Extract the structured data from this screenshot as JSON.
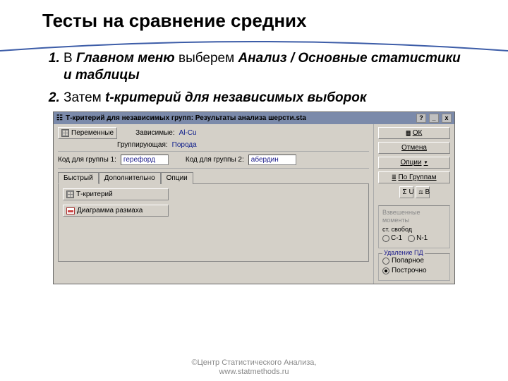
{
  "slide": {
    "title": "Тесты на сравнение средних",
    "items": [
      {
        "lead": "В ",
        "bold": "Главном меню",
        "mid": " выберем ",
        "ital": "Анализ / Основные статистики и таблицы"
      },
      {
        "lead": "Затем ",
        "ital": "t-критерий для независимых выборок"
      }
    ],
    "footer1": "©Центр Статистического Анализа,",
    "footer2": "www.statmethods.ru"
  },
  "win": {
    "title": "Т-критерий для независимых групп: Результаты анализа шерсти.sta",
    "close": "x",
    "min": "_",
    "help": "?",
    "vars_btn": "Переменные",
    "dep_lbl": "Зависимые:",
    "dep_val": "Al-Cu",
    "grp_lbl": "Группирующая:",
    "grp_val": "Порода",
    "code1_lbl": "Код для группы 1:",
    "code1_val": "герефорд",
    "code2_lbl": "Код для группы 2:",
    "code2_val": "абердин",
    "tabs": [
      "Быстрый",
      "Дополнительно",
      "Опции"
    ],
    "tcrit_btn": "Т-критерий",
    "diag_btn": "Диаграмма размаха",
    "ok_btn": "ОК",
    "cancel_btn": "Отмена",
    "opts_btn": "Опции",
    "bygrp_btn": "По Группам",
    "u_btn": "U",
    "b_btn": "B",
    "grp_momenta": "Взвешенные моменты",
    "df_lbl": "ст. свобод",
    "rb1": "С-1",
    "rb2": "N-1",
    "md_legend": "Удаление ПД",
    "md_pair": "Попарное",
    "md_all": "Построчно"
  }
}
